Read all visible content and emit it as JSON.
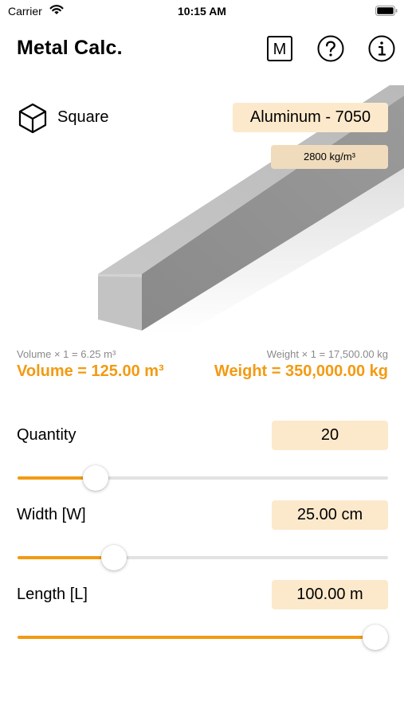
{
  "status_bar": {
    "carrier": "Carrier",
    "time": "10:15 AM"
  },
  "nav": {
    "title": "Metal Calc.",
    "units_button_label": "M"
  },
  "shape": {
    "label": "Square",
    "icon": "cube-icon"
  },
  "material": {
    "name": "Aluminum - 7050",
    "density": "2800 kg/m³"
  },
  "results": {
    "volume_unit": "Volume × 1 = 6.25 m³",
    "weight_unit": "Weight × 1 = 17,500.00 kg",
    "volume_total": "Volume = 125.00 m³",
    "weight_total": "Weight = 350,000.00 kg"
  },
  "fields": [
    {
      "label": "Quantity",
      "value": "20",
      "slider_fraction": 0.21
    },
    {
      "label": "Width [W]",
      "value": "25.00 cm",
      "slider_fraction": 0.26
    },
    {
      "label": "Length [L]",
      "value": "100.00 m",
      "slider_fraction": 1.0
    }
  ],
  "colors": {
    "accent": "#f39a12",
    "field_background": "#fce9cc",
    "badge_background": "#f0dcbd"
  }
}
